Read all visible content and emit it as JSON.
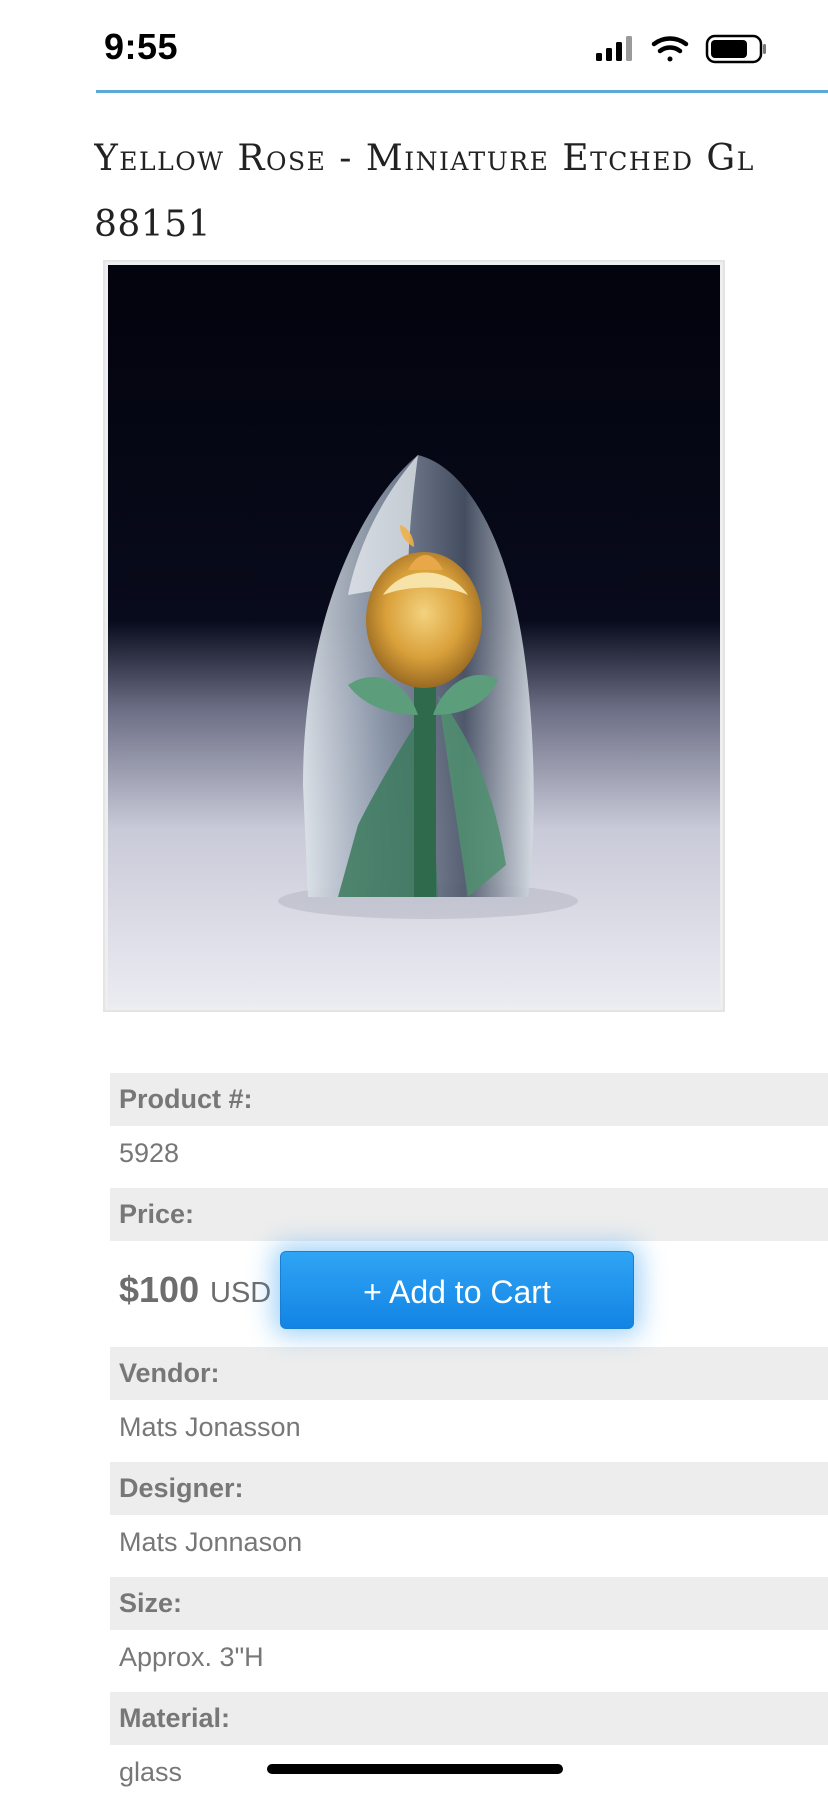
{
  "status_bar": {
    "time": "9:55"
  },
  "product": {
    "title_line1": "Yellow Rose - Miniature Etched Gl",
    "title_line2": "88151"
  },
  "specs": {
    "product_number_label": "Product #:",
    "product_number_value": "5928",
    "price_label": "Price:",
    "price_amount": "$100",
    "price_currency": "USD",
    "add_to_cart_label": "+ Add to Cart",
    "vendor_label": "Vendor:",
    "vendor_value": "Mats Jonasson",
    "designer_label": "Designer:",
    "designer_value": "Mats Jonnason",
    "size_label": "Size:",
    "size_value": "Approx. 3\"H",
    "material_label": "Material:",
    "material_value": "glass"
  },
  "icons": [
    "signal-icon",
    "wifi-icon",
    "battery-icon"
  ],
  "colors": {
    "accent_button": "#1a8cec",
    "header_rule": "#5aa9d6"
  }
}
